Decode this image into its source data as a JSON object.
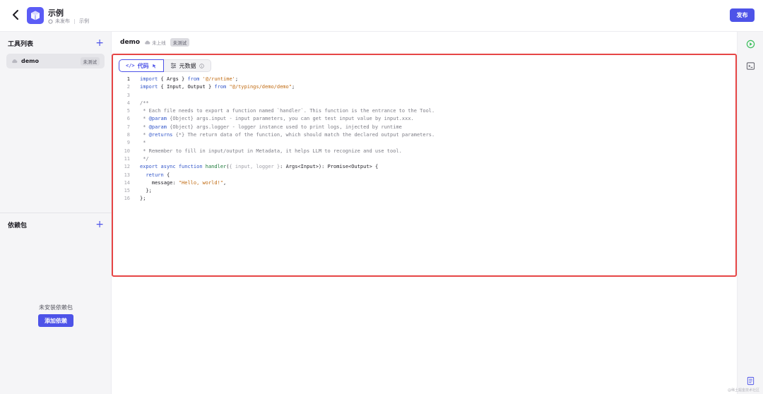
{
  "header": {
    "title": "示例",
    "status": "未发布",
    "project": "示例",
    "publish_label": "发布"
  },
  "sidebar": {
    "tools_title": "工具列表",
    "tool_items": [
      {
        "name": "demo",
        "badge": "未测试"
      }
    ],
    "deps_title": "依赖包",
    "deps_empty": "未安装依赖包",
    "add_dep_label": "添加依赖"
  },
  "main": {
    "title": "demo",
    "status": "未上线",
    "badge": "未测试",
    "tabs": [
      {
        "label": "代码"
      },
      {
        "label": "元数据"
      }
    ]
  },
  "code_lines": [
    "import { Args } from '@/runtime';",
    "import { Input, Output } from \"@/typings/demo/demo\";",
    "",
    "/**",
    " * Each file needs to export a function named `handler`. This function is the entrance to the Tool.",
    " * @param {Object} args.input - input parameters, you can get test input value by input.xxx.",
    " * @param {Object} args.logger - logger instance used to print logs, injected by runtime",
    " * @returns {*} The return data of the function, which should match the declared output parameters.",
    " *",
    " * Remember to fill in input/output in Metadata, it helps LLM to recognize and use tool.",
    " */",
    "export async function handler({ input, logger }: Args<Input>): Promise<Output> {",
    "  return {",
    "    message: \"Hello, world!\",",
    "  };",
    "};"
  ],
  "watermark": "@稀土掘金技术社区",
  "colors": {
    "accent": "#4d53e8",
    "highlight_border": "#e64545",
    "run_icon": "#3bbf5c"
  },
  "icons": {
    "back": "chevron-left-icon",
    "logo": "cube-icon",
    "run": "play-circle-icon",
    "terminal": "terminal-icon",
    "docs": "document-icon"
  }
}
